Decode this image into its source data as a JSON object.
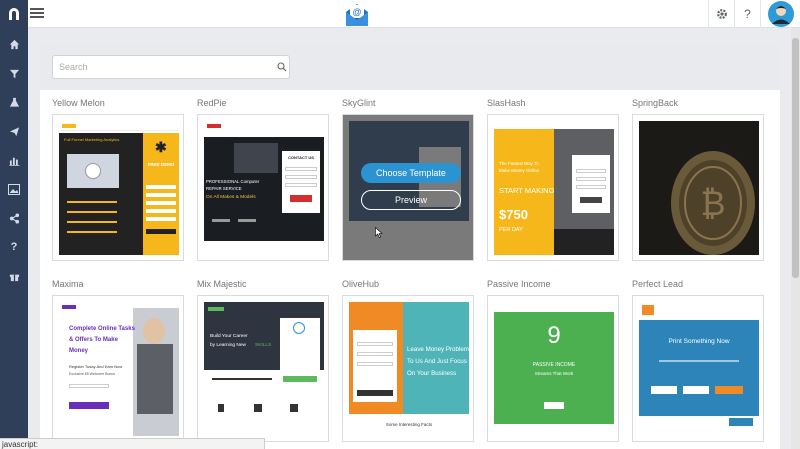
{
  "sidebar": {
    "items": [
      {
        "icon": "home-icon"
      },
      {
        "icon": "funnel-icon"
      },
      {
        "icon": "flask-icon"
      },
      {
        "icon": "paper-plane-icon"
      },
      {
        "icon": "bar-chart-icon"
      },
      {
        "icon": "image-icon"
      },
      {
        "icon": "share-icon"
      },
      {
        "icon": "help-icon"
      },
      {
        "icon": "gift-icon"
      }
    ]
  },
  "header": {
    "logo_icon": "mail-at-icon",
    "settings_icon": "gear-icon",
    "help_label": "?",
    "avatar_icon": "user-avatar-icon"
  },
  "search": {
    "placeholder": "Search"
  },
  "templates": [
    {
      "name": "Yellow Melon"
    },
    {
      "name": "RedPie"
    },
    {
      "name": "SkyGlint"
    },
    {
      "name": "SlasHash"
    },
    {
      "name": "SpringBack"
    },
    {
      "name": "Maxima"
    },
    {
      "name": "Mix Majestic"
    },
    {
      "name": "OliveHub"
    },
    {
      "name": "Passive Income"
    },
    {
      "name": "Perfect Lead"
    }
  ],
  "overlay": {
    "choose_label": "Choose Template",
    "preview_label": "Preview"
  },
  "thumbs": {
    "yellow": {
      "headline": "Full Funnel Marketing Analytics",
      "cta": "FREE DEMO"
    },
    "redpie": {
      "line1": "PROFESSIONAL Computer",
      "line2": "REPAIR SERVICE",
      "line3": "On All Makes & Models",
      "box": "CONTACT US"
    },
    "slashash": {
      "line1": "The Fastest Way To",
      "line2": "Make Money Online",
      "cta": "START MAKING",
      "amount": "$750",
      "sub": "PER DAY"
    },
    "maxima": {
      "line1": "Complete Online Tasks",
      "line2": "& Offers To Make",
      "line3": "Money",
      "sub": "Register Today And Earn Now",
      "sub2": "Exclusive $5 Welcome Bonus"
    },
    "mix": {
      "line1": "Build Your Career",
      "line2": "by Learning New",
      "accent": "SKILLS"
    },
    "olive": {
      "line1": "Leave Money Problem",
      "line2": "To Us And Just Focus",
      "line3": "On Your Business",
      "footer": "Some Interesting Facts"
    },
    "passive": {
      "num": "9",
      "line1": "PASSIVE INCOME",
      "line2": "Streams That Work"
    },
    "perfect": {
      "line1": "Print Something Now"
    }
  },
  "status": {
    "text": "javascript:"
  },
  "colors": {
    "sidebar": "#2f3f5a",
    "accent_blue": "#2b93d1",
    "yellow": "#f6b71a"
  }
}
